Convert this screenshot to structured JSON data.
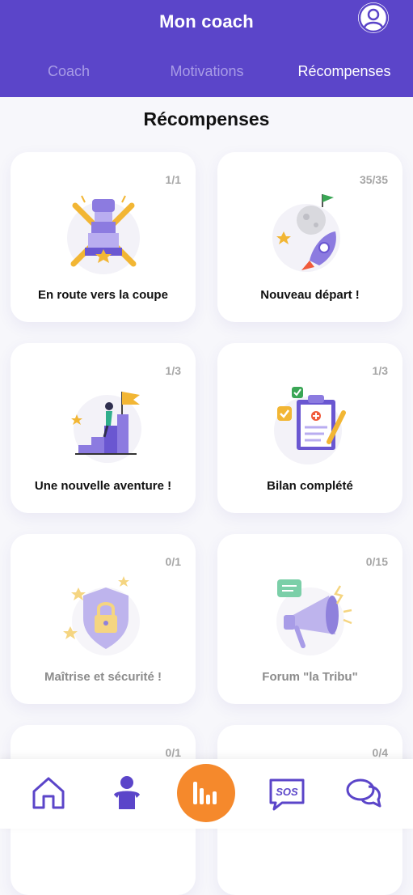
{
  "header": {
    "title": "Mon coach",
    "tabs": [
      {
        "label": "Coach",
        "active": false
      },
      {
        "label": "Motivations",
        "active": false
      },
      {
        "label": "Récompenses",
        "active": true
      }
    ]
  },
  "page": {
    "title": "Récompenses"
  },
  "rewards": [
    {
      "label": "En route vers la coupe",
      "count": "1/1",
      "locked": false,
      "icon": "hockey-cup-icon"
    },
    {
      "label": "Nouveau départ !",
      "count": "35/35",
      "locked": false,
      "icon": "rocket-icon"
    },
    {
      "label": "Une nouvelle aventure !",
      "count": "1/3",
      "locked": false,
      "icon": "summit-flag-icon"
    },
    {
      "label": "Bilan complété",
      "count": "1/3",
      "locked": false,
      "icon": "clipboard-check-icon"
    },
    {
      "label": "Maîtrise et sécurité !",
      "count": "0/1",
      "locked": true,
      "icon": "shield-lock-icon"
    },
    {
      "label": "Forum \"la Tribu\"",
      "count": "0/15",
      "locked": true,
      "icon": "megaphone-icon"
    },
    {
      "label": "",
      "count": "0/1",
      "locked": true,
      "icon": ""
    },
    {
      "label": "",
      "count": "0/4",
      "locked": true,
      "icon": ""
    }
  ],
  "bottom_nav": [
    {
      "icon": "home-icon"
    },
    {
      "icon": "profile-icon"
    },
    {
      "icon": "stats-icon"
    },
    {
      "icon": "sos-icon",
      "text": "SOS"
    },
    {
      "icon": "chat-icon"
    }
  ],
  "colors": {
    "primary": "#5b45c9",
    "accent": "#f5892c",
    "tab_inactive": "#a89ce6",
    "count_gray": "#a6a6a6"
  }
}
